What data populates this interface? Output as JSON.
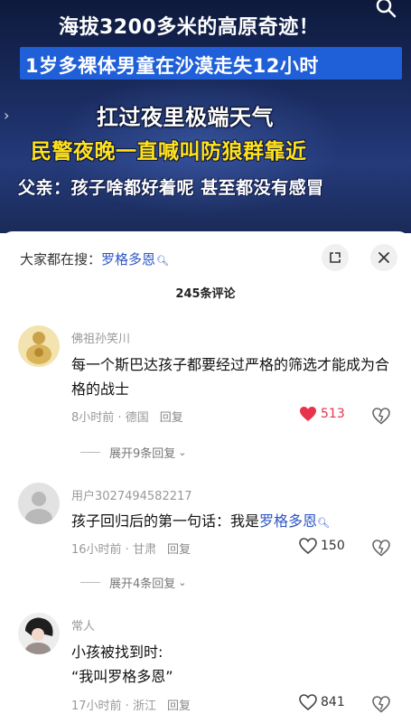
{
  "video": {
    "line1": "海拔3200多米的高原奇迹！",
    "line2": "1岁多裸体男童在沙漠走失12小时",
    "line3": "扛过夜里极端天气",
    "line4": "民警夜晚一直喊叫防狼群靠近",
    "line5": "父亲：孩子啥都好着呢 甚至都没有感冒"
  },
  "sheet": {
    "search_prefix": "大家都在搜：",
    "search_keyword": "罗格多恩",
    "count_label": "245条评论"
  },
  "comments": [
    {
      "username": "佛祖孙笑川",
      "text": "每一个斯巴达孩子都要经过严格的筛选才能成为合格的战士",
      "time": "8小时前",
      "location": "德国",
      "reply_label": "回复",
      "likes": "513",
      "liked": true,
      "expand_label": "展开9条回复"
    },
    {
      "username": "用户3027494582217",
      "text_prefix": "孩子回归后的第一句话：我是",
      "text_keyword": "罗格多恩",
      "time": "16小时前",
      "location": "甘肃",
      "reply_label": "回复",
      "likes": "150",
      "liked": false,
      "expand_label": "展开4条回复"
    },
    {
      "username": "常人",
      "text_line1": "小孩被找到时:",
      "text_line2": "“我叫罗格多恩”",
      "time": "17小时前",
      "location": "浙江",
      "reply_label": "回复",
      "likes": "841",
      "liked": false
    }
  ],
  "colors": {
    "accent_blue": "#2d56c4",
    "like_red": "#e8334a",
    "subtitle_yellow": "#ffe21a"
  },
  "icons": [
    "close-icon",
    "side-arrow-icon",
    "search-icon",
    "expand-icon",
    "heart-icon",
    "dislike-icon",
    "chevron-down-icon"
  ]
}
